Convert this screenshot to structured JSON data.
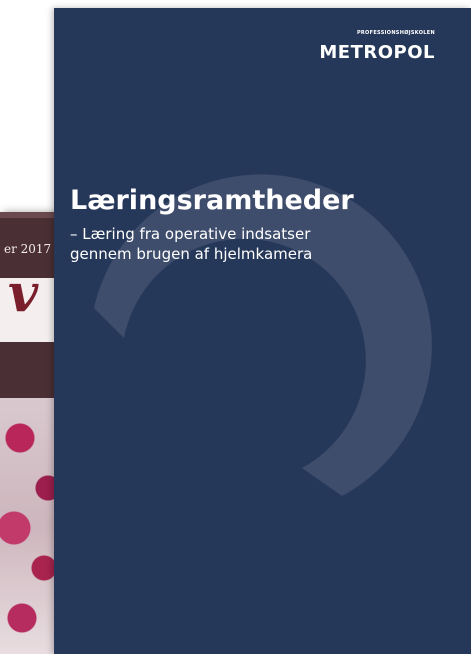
{
  "back_cover": {
    "date_text": "er 2017",
    "letter": "v"
  },
  "front_cover": {
    "brand_tagline": "PROFESSIONSHØJSKOLEN",
    "brand_logo": "METROPOL",
    "title": "Læringsramtheder",
    "subtitle_line1": "– Læring fra operative indsatser",
    "subtitle_line2": "gennem brugen af hjelmkamera"
  },
  "colors": {
    "cover_background": "#26385a",
    "arc": "#3f4d6c",
    "back_cover_background": "#4a3035",
    "back_cover_letter": "#7a1e2c",
    "text": "#ffffff"
  }
}
